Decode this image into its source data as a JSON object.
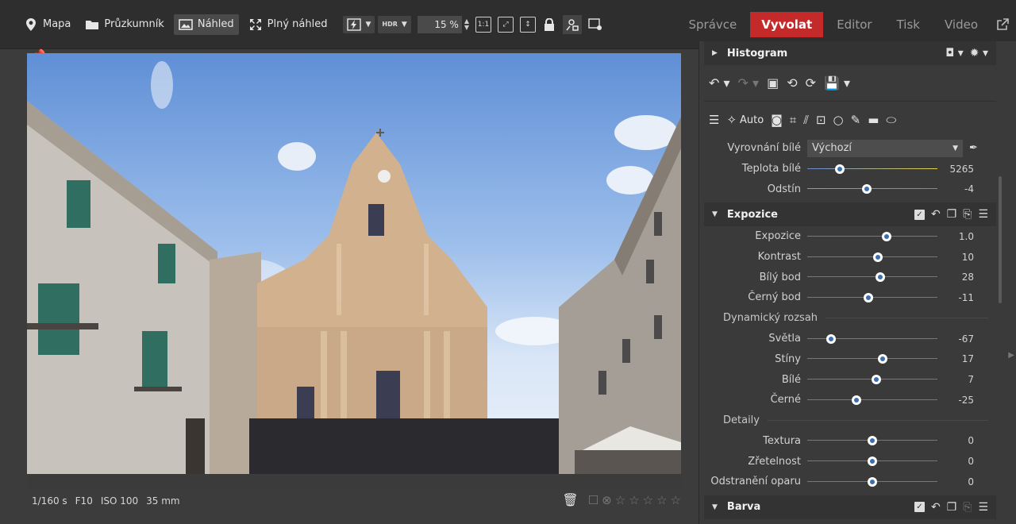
{
  "toolbar": {
    "map": "Mapa",
    "explorer": "Průzkumník",
    "preview": "Náhled",
    "fullscreen": "Plný náhled",
    "hdr": "HDR",
    "zoom": "15 %",
    "one_to_one": "1:1"
  },
  "tabs": [
    "Správce",
    "Vyvolat",
    "Editor",
    "Tisk",
    "Video"
  ],
  "photo_info": {
    "shutter": "1/160 s",
    "aperture": "F10",
    "iso": "ISO 100",
    "focal": "35 mm"
  },
  "panel": {
    "histogram": "Histogram",
    "auto": "Auto",
    "wb_label": "Vyrovnání bílé",
    "wb_value": "Výchozí",
    "temp_label": "Teplota bílé",
    "temp_value": "5265",
    "tint_label": "Odstín",
    "tint_value": "-4",
    "exposure_section": "Expozice",
    "dynamic_range": "Dynamický rozsah",
    "details": "Detaily",
    "color_section": "Barva",
    "exposure_rows": [
      {
        "label": "Expozice",
        "value": "1.0",
        "pos": 0.61
      },
      {
        "label": "Kontrast",
        "value": "10",
        "pos": 0.54
      },
      {
        "label": "Bílý bod",
        "value": "28",
        "pos": 0.56
      },
      {
        "label": "Černý bod",
        "value": "-11",
        "pos": 0.47
      }
    ],
    "dynamic_rows": [
      {
        "label": "Světla",
        "value": "-67",
        "pos": 0.18
      },
      {
        "label": "Stíny",
        "value": "17",
        "pos": 0.58
      },
      {
        "label": "Bílé",
        "value": "7",
        "pos": 0.53
      },
      {
        "label": "Černé",
        "value": "-25",
        "pos": 0.38
      }
    ],
    "detail_rows": [
      {
        "label": "Textura",
        "value": "0",
        "pos": 0.5
      },
      {
        "label": "Zřetelnost",
        "value": "0",
        "pos": 0.5
      },
      {
        "label": "Odstranění oparu",
        "value": "0",
        "pos": 0.5
      }
    ],
    "temp_pos": 0.25,
    "tint_pos": 0.46
  },
  "colors": {
    "accent": "#c52a2a",
    "panel_bg": "#3a3a3a",
    "toolbar_bg": "#2e2e2e"
  }
}
